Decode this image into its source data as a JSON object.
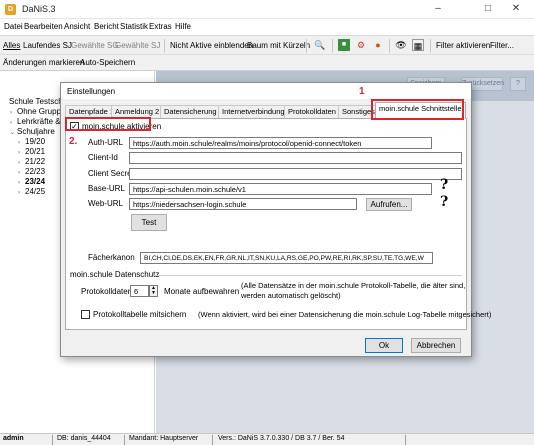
{
  "window": {
    "title": "DaNiS.3"
  },
  "menu": [
    "Datei",
    "Bearbeiten",
    "Ansicht",
    "Bericht",
    "Statistik",
    "Extras",
    "Hilfe"
  ],
  "toolbar1": {
    "alles": "Alles",
    "laufendes_sj": "Laufendes SJ",
    "gewaehlte_sg": "Gewählte SG",
    "gewaehlte_sj": "Gewählte SJ",
    "nicht_aktive": "Nicht Aktive einblenden",
    "baum_mit_kuerzeln": "Baum mit Kürzeln",
    "filter_aktivieren": "Filter aktivieren",
    "filter_more": "Filter..."
  },
  "toolbar2": {
    "aenderungen": "Änderungen markieren",
    "auto_speichern": "Auto-Speichern"
  },
  "right_buttons": [
    "Speichern",
    "Zurücksetzen"
  ],
  "tree": [
    {
      "label": "Schule Testsch",
      "indent": 0,
      "expander": "",
      "bold": false
    },
    {
      "label": "Ohne Gruppenz",
      "indent": 1,
      "expander": "›",
      "bold": false
    },
    {
      "label": "Lehrkräfte & we",
      "indent": 1,
      "expander": "›",
      "bold": false
    },
    {
      "label": "Schuljahre",
      "indent": 1,
      "expander": "⌄",
      "bold": false
    },
    {
      "label": "19/20",
      "indent": 2,
      "expander": "›",
      "bold": false
    },
    {
      "label": "20/21",
      "indent": 2,
      "expander": "›",
      "bold": false
    },
    {
      "label": "21/22",
      "indent": 2,
      "expander": "›",
      "bold": false
    },
    {
      "label": "22/23",
      "indent": 2,
      "expander": "›",
      "bold": false
    },
    {
      "label": "23/24",
      "indent": 2,
      "expander": "›",
      "bold": true
    },
    {
      "label": "24/25",
      "indent": 2,
      "expander": "›",
      "bold": false
    }
  ],
  "status": {
    "user": "admin",
    "db": "DB: danis_44404",
    "mandant": "Mandant: Hauptserver",
    "version": "Vers.: DaNiS 3.7.0.330 / DB 3.7 / Ber. 54"
  },
  "dialog": {
    "title": "Einstellungen",
    "tabs": [
      "Datenpfade 1",
      "Anmeldung 2",
      "Datensicherung",
      "Internetverbindung",
      "Protokolldaten",
      "Sonstiges",
      "moin.schule Schnittstelle"
    ],
    "active_tab": 6,
    "annotation_1": "1",
    "annotation_2": "2.",
    "aktivieren_label": "moin.schule aktivieren",
    "aktivieren_checked": true,
    "fields": {
      "auth_url_label": "Auth-URL",
      "auth_url_value": "https://auth.moin.schule/realms/moins/protocol/openid-connect/token",
      "client_id_label": "Client-Id",
      "client_id_value": "",
      "client_secret_label": "Client Secret",
      "client_secret_value": "",
      "base_url_label": "Base-URL",
      "base_url_value": "https://api-schulen.moin.schule/v1",
      "web_url_label": "Web-URL",
      "web_url_value": "https://niedersachsen-login.schule"
    },
    "help_icon": "?",
    "aufrufen_label": "Aufrufen...",
    "test_label": "Test",
    "faecherkanon_label": "Fächerkanon",
    "faecherkanon_value": "BI,CH,CI,DE,DS,EK,EN,FR,GR,NL,IT,SN,KU,LA,RS,GE,PO,PW,RE,RI,RK,SP,SU,TE,TG,WE,W",
    "datenschutz_title": "moin.schule Datenschutz",
    "protokolldaten_label": "Protokolldaten",
    "protokolldaten_value": "6",
    "monate_label": "Monate aufbewahren",
    "protokolldaten_note_1": "(Alle Datensätze in der moin.schule Protokoll-Tabelle, die älter sind,",
    "protokolldaten_note_2": "werden automatisch gelöscht)",
    "mitschreiben_label": "Protokolltabelle mitsichern",
    "mitschreiben_note": "(Wenn aktiviert, wird bei einer Datensicherung die moin.schule Log-Tabelle mitgesichert)",
    "ok_label": "Ok",
    "abbrechen_label": "Abbrechen"
  }
}
